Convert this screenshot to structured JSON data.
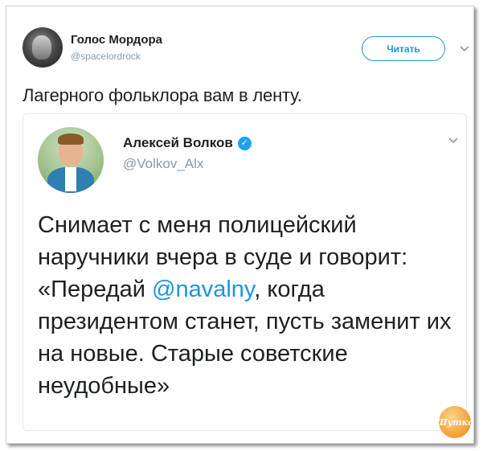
{
  "outer_tweet": {
    "user_name": "Голос Мордора",
    "user_handle": "@spacelordrock",
    "follow_label": "Читать",
    "text": "Лагерного фольклора вам в ленту."
  },
  "quoted_tweet": {
    "user_name": "Алексей Волков",
    "verified_mark": "✓",
    "user_handle": "@Volkov_Alx",
    "text_before": "Снимает с меня полицейский наручники вчера в суде и говорит: «Передай ",
    "mention": "@navalny",
    "text_after": ", когда президентом станет, пусть заменит их на новые. Старые советские неудобные»"
  },
  "watermark_logo": "Шутка",
  "colors": {
    "link": "#1b95e0",
    "text": "#1c2022",
    "muted": "#8899a6",
    "border": "#e1e8ed",
    "verified": "#1da1f2"
  },
  "icons": {
    "outer_menu": "chevron-down-icon",
    "quote_menu": "chevron-down-icon",
    "verified": "verified-badge-icon"
  }
}
